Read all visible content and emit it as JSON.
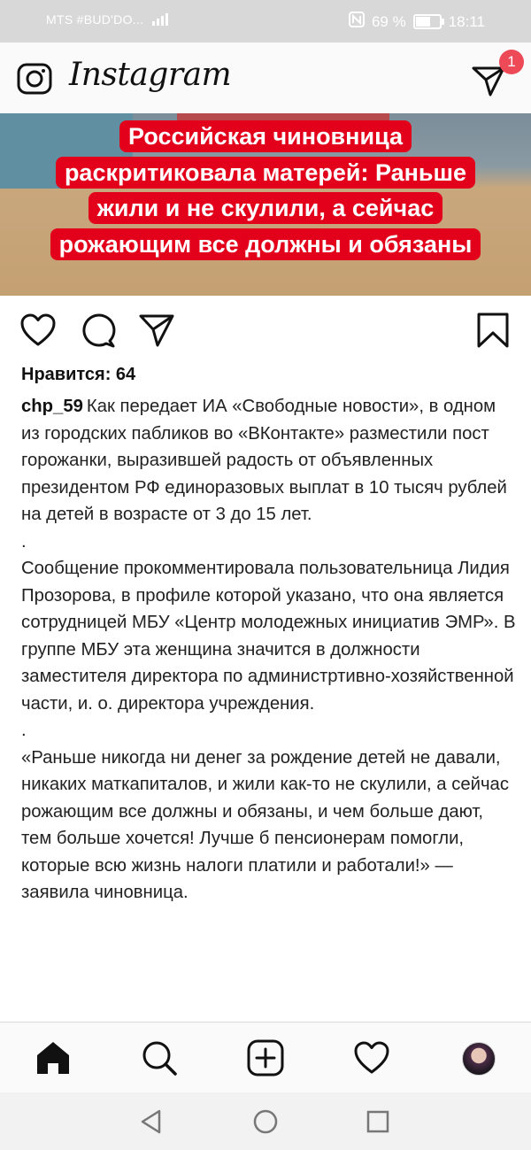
{
  "status_bar": {
    "carrier": "MTS #BUD'DO...",
    "battery_percent": "69 %",
    "time": "18:11"
  },
  "header": {
    "title": "Instagram",
    "direct_badge_count": "1"
  },
  "post": {
    "image_headline": "Российская чиновница раскритиковала матерей: Раньше жили и не скулили, а сейчас рожающим все должны и обязаны",
    "likes_label": "Нравится: 64",
    "username": "chp_59",
    "caption_paragraphs": [
      "Как передает ИА «Свободные новости», в одном из городских пабликов во «ВКонтакте» разместили пост горожанки, выразившей радость от объявленных президентом РФ единоразовых выплат в 10 тысяч рублей на детей в возрасте от 3 до 15 лет.",
      ".",
      "Сообщение прокомментировала пользовательница Лидия Прозорова, в профиле которой указано, что она является сотрудницей МБУ «Центр молодежных инициатив ЭМР». В группе МБУ эта женщина значится в должности заместителя директора по администртивно-хозяйственной части, и. о. директора учреждения.",
      ".",
      "«Раньше никогда ни денег за рождение детей не давали, никаких маткапиталов, и жили как-то не скулили, а сейчас рожающим все должны и обязаны, и чем больше дают, тем больше хочется! Лучше б пенсионерам помогли, которые всю жизнь налоги платили и работали!» — заявила чиновница."
    ]
  }
}
